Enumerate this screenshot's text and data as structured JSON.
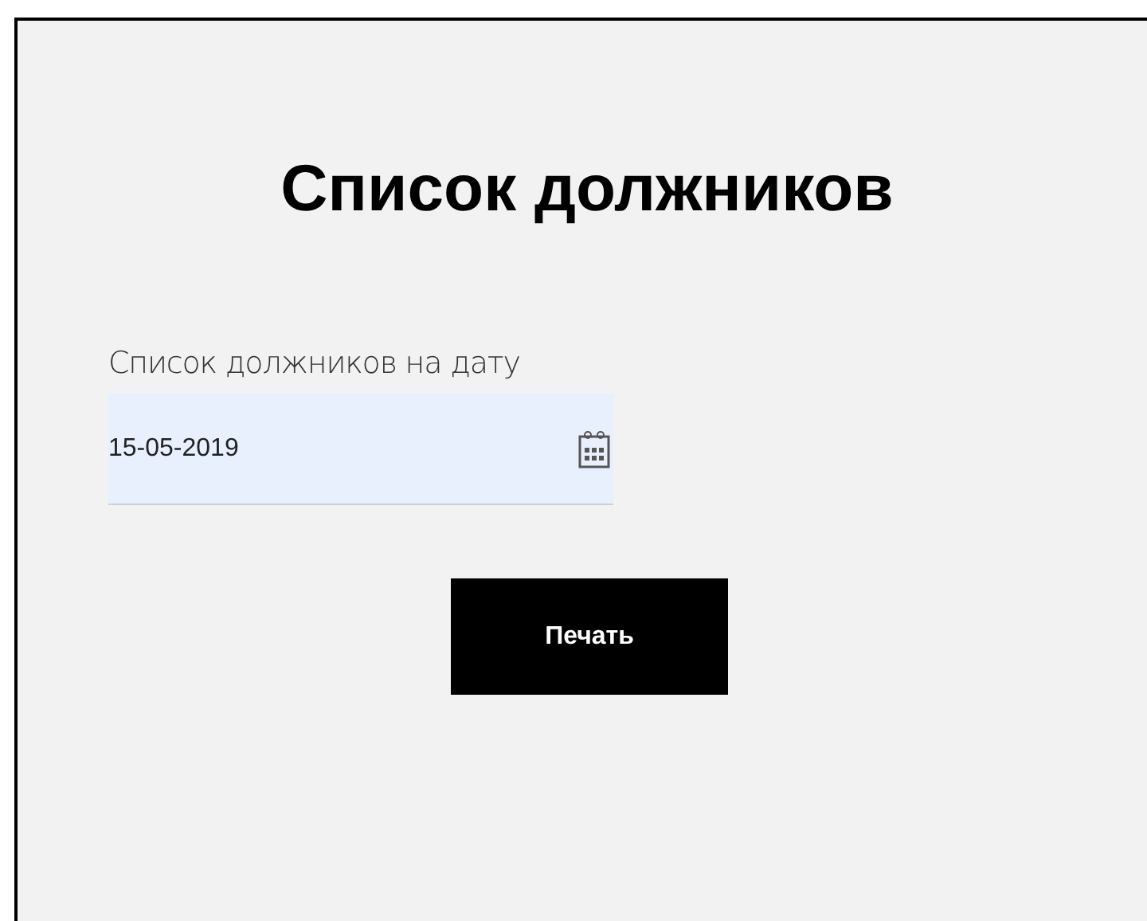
{
  "title": "Список должников",
  "date_field": {
    "label": "Список должников на дату",
    "value": "15-05-2019"
  },
  "print_button": {
    "label": "Печать"
  }
}
